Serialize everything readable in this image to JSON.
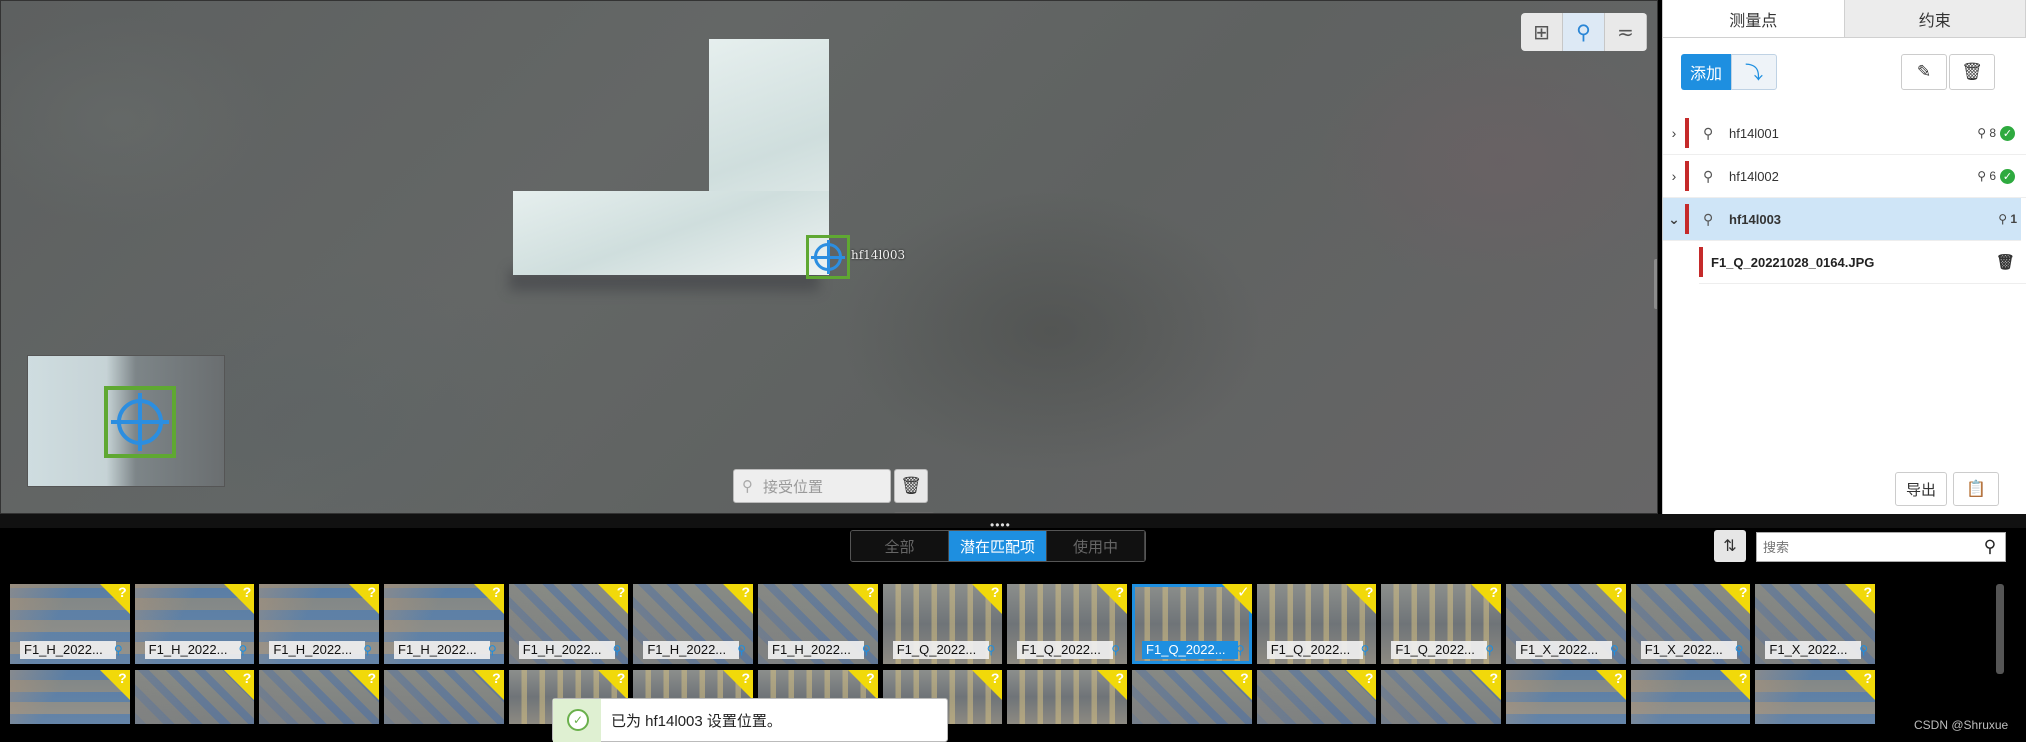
{
  "viewer": {
    "gcp_label": "hf14l003",
    "tools": [
      {
        "icon": "grid-view-icon",
        "glyph": "⊞"
      },
      {
        "icon": "gcp-markers-icon",
        "glyph": "⚲"
      },
      {
        "icon": "line-tool-icon",
        "glyph": "≂"
      }
    ],
    "accept_placeholder": "接受位置"
  },
  "panel": {
    "tabs": [
      "测量点",
      "约束"
    ],
    "add_label": "添加",
    "export_label": "导出",
    "gcps": [
      {
        "name": "hf14l001",
        "count": "8",
        "verified": true,
        "expanded": false,
        "selected": false
      },
      {
        "name": "hf14l002",
        "count": "6",
        "verified": true,
        "expanded": false,
        "selected": false
      },
      {
        "name": "hf14l003",
        "count": "1",
        "verified": false,
        "expanded": true,
        "selected": true
      }
    ],
    "image_entry": "F1_Q_20221028_0164.JPG"
  },
  "strip": {
    "filters": [
      "全部",
      "潜在匹配项",
      "使用中"
    ],
    "active_filter": "潜在匹配项",
    "search_placeholder": "搜索",
    "row1": [
      "F1_H_2022...",
      "F1_H_2022...",
      "F1_H_2022...",
      "F1_H_2022...",
      "F1_H_2022...",
      "F1_H_2022...",
      "F1_H_2022...",
      "F1_Q_2022...",
      "F1_Q_2022...",
      "F1_Q_2022...",
      "F1_Q_2022...",
      "F1_Q_2022...",
      "F1_X_2022...",
      "F1_X_2022...",
      "F1_X_2022..."
    ],
    "selected_index": 9
  },
  "toast": {
    "message": "已为 hf14l003 设置位置。"
  },
  "watermark": "CSDN @Shruxue",
  "colors": {
    "accent": "#1e8fe0",
    "marker_green": "#5fa832",
    "marker_blue": "#2c8ee0",
    "warning_yellow": "#f1d90a",
    "error_red": "#c52a2a",
    "ok_green": "#2eaa3f"
  }
}
